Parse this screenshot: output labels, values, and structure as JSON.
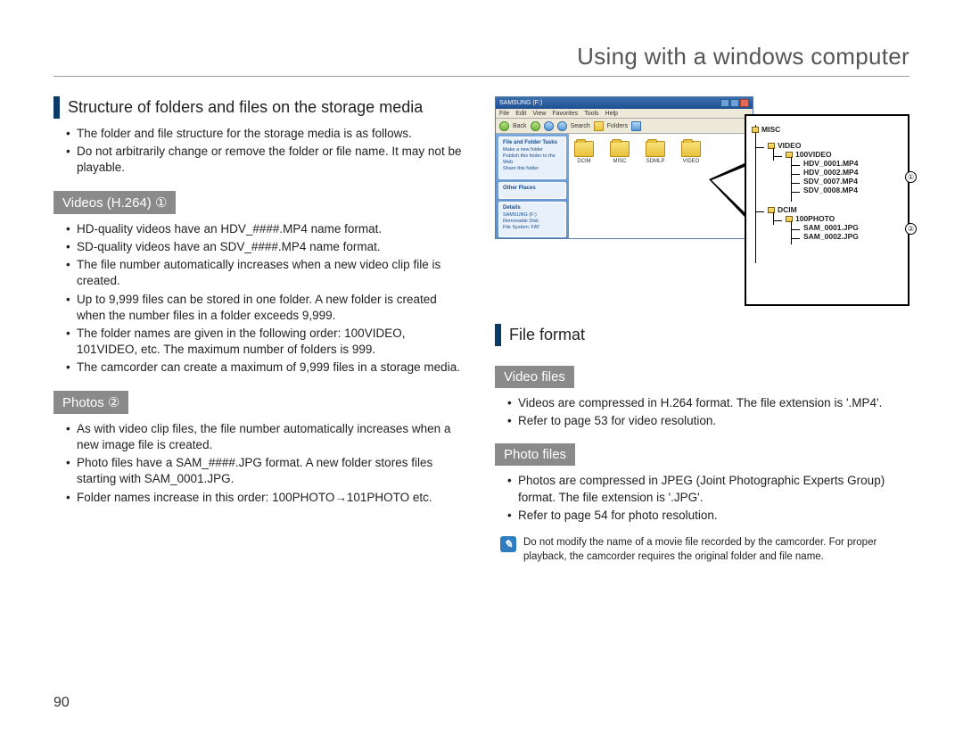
{
  "page_title": "Using with a windows computer",
  "page_number": "90",
  "heading_structure": "Structure of folders and files on the storage media",
  "intro_bullets": [
    "The folder and file structure for the storage media is as follows.",
    "Do not arbitrarily change or remove the folder or file name. It may not be playable."
  ],
  "heading_videos": "Videos (H.264) ①",
  "videos_bullets": [
    "HD-quality videos have an HDV_####.MP4 name format.",
    "SD-quality videos have an SDV_####.MP4 name format.",
    "The file number automatically increases when a new video clip file is created.",
    "Up to 9,999 files can be stored in one folder. A new folder is created when the number files in a folder exceeds 9,999.",
    "The folder names are given in the following order: 100VIDEO, 101VIDEO, etc. The maximum number of folders is 999.",
    "The camcorder can create a maximum of 9,999 files in a storage media."
  ],
  "heading_photos": "Photos ②",
  "photos_bullets": [
    "As with video clip files, the file number automatically increases when a new image file is created.",
    "Photo files have a SAM_####.JPG format. A new folder stores files starting with SAM_0001.JPG.",
    "Folder names increase in this order: 100PHOTO→101PHOTO etc."
  ],
  "heading_fileformat": "File format",
  "heading_videofiles": "Video files",
  "videofiles_bullets": [
    "Videos are compressed in H.264 format. The file extension is '.MP4'.",
    "Refer to page 53 for video resolution."
  ],
  "heading_photofiles": "Photo files",
  "photofiles_bullets": [
    "Photos are compressed in JPEG (Joint Photographic Experts Group) format. The file extension is '.JPG'.",
    "Refer to page 54 for photo resolution."
  ],
  "note_text": "Do not modify the name of a movie file recorded by the camcorder. For proper playback, the camcorder requires the original folder and file name.",
  "explorer": {
    "menu": [
      "File",
      "Edit",
      "View",
      "Favorites",
      "Tools",
      "Help"
    ],
    "toolbar": {
      "back": "Back",
      "search": "Search",
      "folders": "Folders"
    },
    "side_panels": [
      {
        "title": "File and Folder Tasks",
        "lines": [
          "Make a new folder",
          "Publish this folder to the Web",
          "Share this folder"
        ]
      },
      {
        "title": "Other Places",
        "lines": [
          ""
        ]
      },
      {
        "title": "Details",
        "lines": [
          "SAMSUNG (F:)",
          "Removable Disk",
          "File System: FAT"
        ]
      }
    ],
    "folders": [
      "DCIM",
      "MISC",
      "SDMLP",
      "VIDEO"
    ]
  },
  "tree": {
    "n_misc": "MISC",
    "n_video": "VIDEO",
    "n_100video": "100VIDEO",
    "f_hdv1": "HDV_0001.MP4",
    "f_hdv2": "HDV_0002.MP4",
    "f_sdv7": "SDV_0007.MP4",
    "f_sdv8": "SDV_0008.MP4",
    "n_dcim": "DCIM",
    "n_100photo": "100PHOTO",
    "f_sam1": "SAM_0001.JPG",
    "f_sam2": "SAM_0002.JPG",
    "badge1": "①",
    "badge2": "②"
  }
}
